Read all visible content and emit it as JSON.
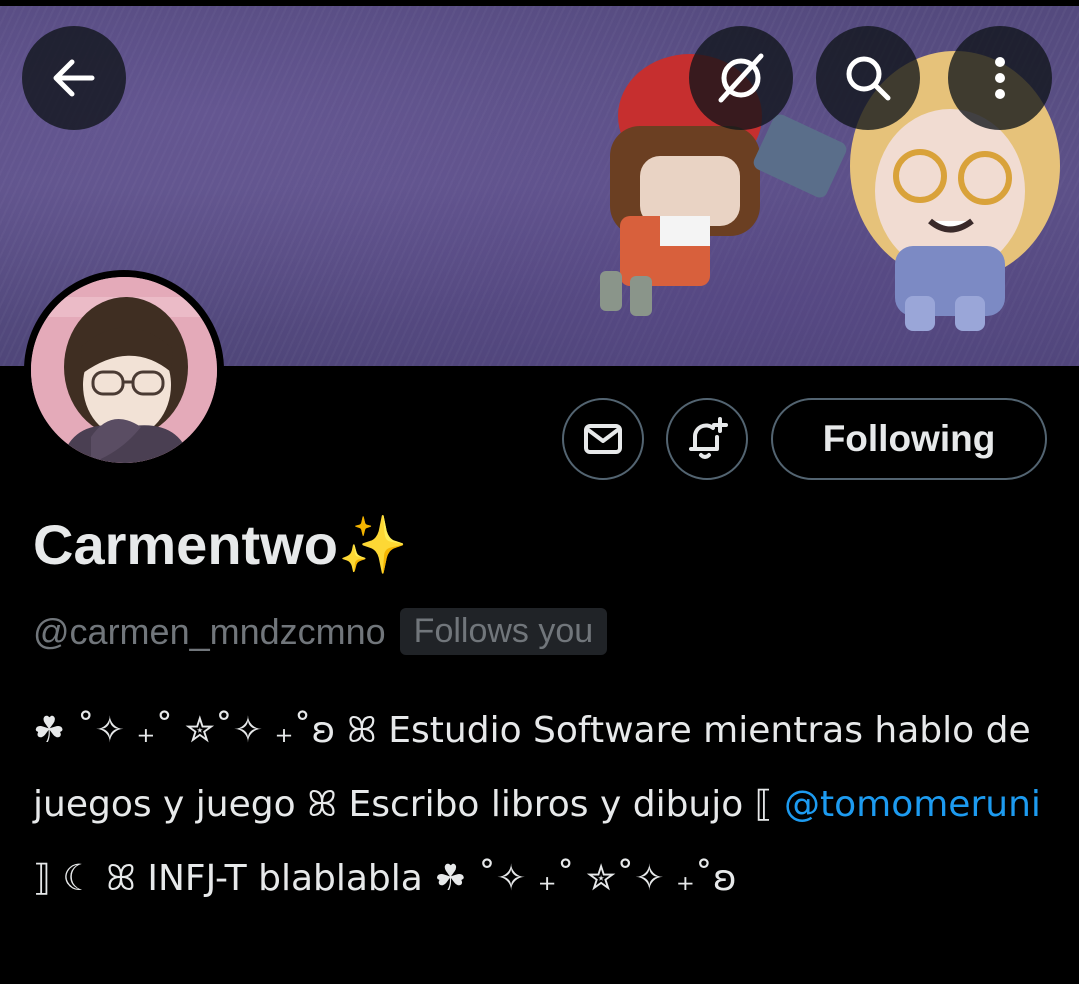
{
  "profile": {
    "display_name": "Carmentwo✨",
    "handle": "@carmen_mndzcmno",
    "follows_you_badge": "Follows you",
    "bio_part1": "☘︎ ˚✧ ₊˚ ✮˚✧ ₊˚ʚ ꕤ Estudio Software mientras hablo de juegos y juego ꕤ Escribo libros y dibujo ⟦ ",
    "bio_mention": "@tomomeruni",
    "bio_part2": " ⟧ ☾ ꕤ INFJ-T blablabla ☘︎ ˚✧ ₊˚ ✮˚✧ ₊˚ʚ"
  },
  "actions": {
    "follow_label": "Following"
  },
  "icons": {
    "back": "back-arrow-icon",
    "grok": "grok-icon",
    "search": "search-icon",
    "more": "more-vertical-icon",
    "message": "mail-icon",
    "notify": "bell-plus-icon"
  },
  "colors": {
    "background": "#000000",
    "text": "#e7e9ea",
    "muted": "#71767b",
    "link": "#1d9bf0",
    "border": "#536471",
    "badge_bg": "#202327"
  }
}
